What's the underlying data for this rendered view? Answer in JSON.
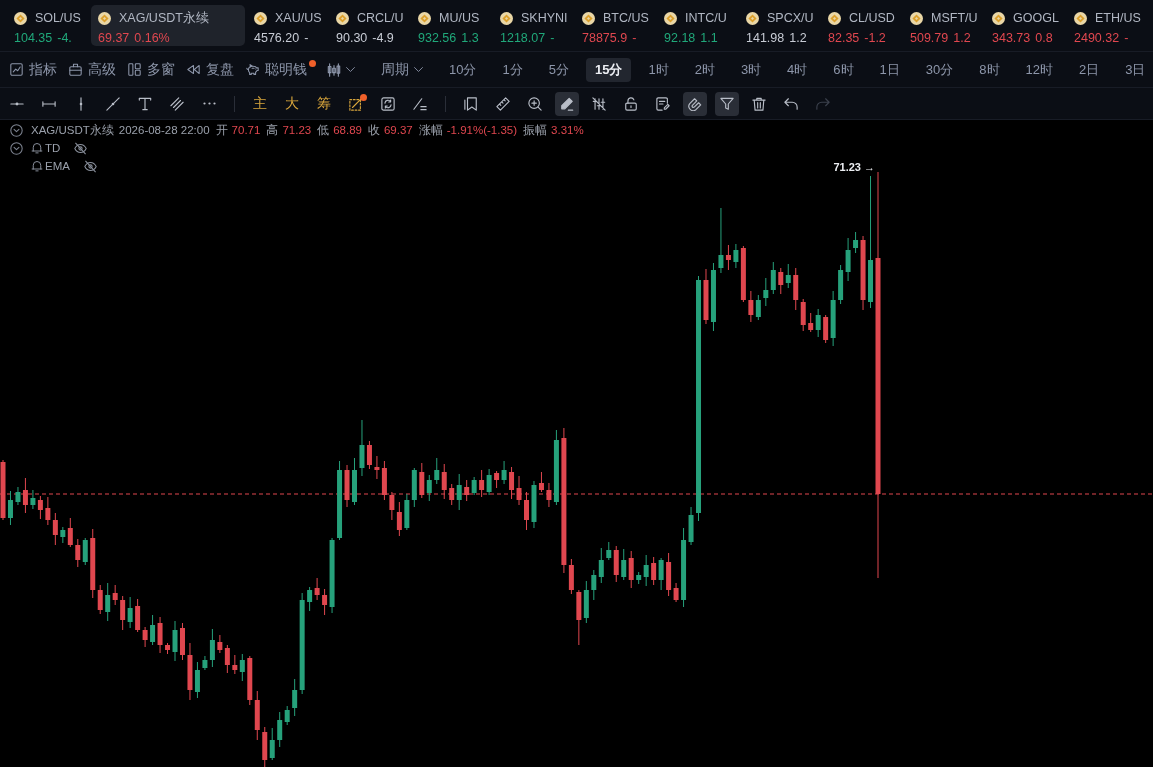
{
  "tickers": [
    {
      "symbol": "SOL/US",
      "price": "104.35",
      "change": "-4.",
      "color": "#20a87a",
      "selected": false
    },
    {
      "symbol": "XAG/USDT永续",
      "price": "69.37",
      "change": "0.16%",
      "color": "#e0474f",
      "selected": true
    },
    {
      "symbol": "XAU/US",
      "price": "4576.20",
      "change": "-",
      "color": "#c8ccd5",
      "selected": false
    },
    {
      "symbol": "CRCL/U",
      "price": "90.30",
      "change": "-4.9",
      "color": "#c8ccd5",
      "selected": false
    },
    {
      "symbol": "MU/US",
      "price": "932.56",
      "change": "1.3",
      "color": "#20a87a",
      "selected": false
    },
    {
      "symbol": "SKHYNI",
      "price": "1218.07",
      "change": "-",
      "color": "#20a87a",
      "selected": false
    },
    {
      "symbol": "BTC/US",
      "price": "78875.9",
      "change": "-",
      "color": "#e0474f",
      "selected": false
    },
    {
      "symbol": "INTC/U",
      "price": "92.18",
      "change": "1.1",
      "color": "#20a87a",
      "selected": false
    },
    {
      "symbol": "SPCX/U",
      "price": "141.98",
      "change": "1.2",
      "color": "#c8ccd5",
      "selected": false
    },
    {
      "symbol": "CL/USD",
      "price": "82.35",
      "change": "-1.2",
      "color": "#e0474f",
      "selected": false
    },
    {
      "symbol": "MSFT/U",
      "price": "509.79",
      "change": "1.2",
      "color": "#e0474f",
      "selected": false
    },
    {
      "symbol": "GOOGL",
      "price": "343.73",
      "change": "0.8",
      "color": "#e0474f",
      "selected": false
    },
    {
      "symbol": "ETH/US",
      "price": "2490.32",
      "change": "-",
      "color": "#e0474f",
      "selected": false
    }
  ],
  "toolbar": {
    "menus": [
      {
        "label": "指标",
        "badge": false
      },
      {
        "label": "高级",
        "badge": false
      },
      {
        "label": "多窗",
        "badge": false
      },
      {
        "label": "复盘",
        "badge": false
      },
      {
        "label": "聪明钱",
        "badge": true
      }
    ],
    "period": {
      "label": "周期"
    },
    "intervals": [
      {
        "label": "10分",
        "selected": false
      },
      {
        "label": "1分",
        "selected": false
      },
      {
        "label": "5分",
        "selected": false
      },
      {
        "label": "15分",
        "selected": true
      },
      {
        "label": "1时",
        "selected": false
      },
      {
        "label": "2时",
        "selected": false
      },
      {
        "label": "3时",
        "selected": false
      },
      {
        "label": "4时",
        "selected": false
      },
      {
        "label": "6时",
        "selected": false
      },
      {
        "label": "1日",
        "selected": false
      },
      {
        "label": "30分",
        "selected": false
      },
      {
        "label": "8时",
        "selected": false
      },
      {
        "label": "12时",
        "selected": false
      },
      {
        "label": "2日",
        "selected": false
      },
      {
        "label": "3日",
        "selected": false
      }
    ]
  },
  "tools": {
    "indicator_tools": [
      {
        "kind": "text",
        "label": "主",
        "badge": false
      },
      {
        "kind": "text",
        "label": "大",
        "badge": false
      },
      {
        "kind": "text",
        "label": "筹",
        "badge": false
      },
      {
        "kind": "icon",
        "badge": true
      },
      {
        "kind": "icon",
        "badge": false
      },
      {
        "kind": "icon",
        "badge": false
      }
    ],
    "utility_tools": [
      {
        "active": false,
        "disabled": false
      },
      {
        "active": false,
        "disabled": false
      },
      {
        "active": false,
        "disabled": false
      },
      {
        "active": true,
        "disabled": false
      },
      {
        "active": false,
        "disabled": false
      },
      {
        "active": false,
        "disabled": false
      },
      {
        "active": false,
        "disabled": false
      },
      {
        "active": true,
        "disabled": false
      },
      {
        "active": true,
        "disabled": false
      },
      {
        "active": false,
        "disabled": false
      },
      {
        "active": false,
        "disabled": false
      },
      {
        "active": false,
        "disabled": true
      }
    ]
  },
  "legend": {
    "symbol": "XAG/USDT永续",
    "time": "2026-08-28 22:00",
    "fields": [
      {
        "label": "开",
        "value": "70.71"
      },
      {
        "label": "高",
        "value": "71.23"
      },
      {
        "label": "低",
        "value": "68.89"
      },
      {
        "label": "收",
        "value": "69.37"
      },
      {
        "label": "涨幅",
        "value": "-1.91%(-1.35)"
      },
      {
        "label": "振幅",
        "value": "3.31%"
      }
    ],
    "indicators": [
      {
        "name": "TD"
      },
      {
        "name": "EMA"
      }
    ]
  },
  "chart": {
    "high_label": "71.23 →"
  }
}
